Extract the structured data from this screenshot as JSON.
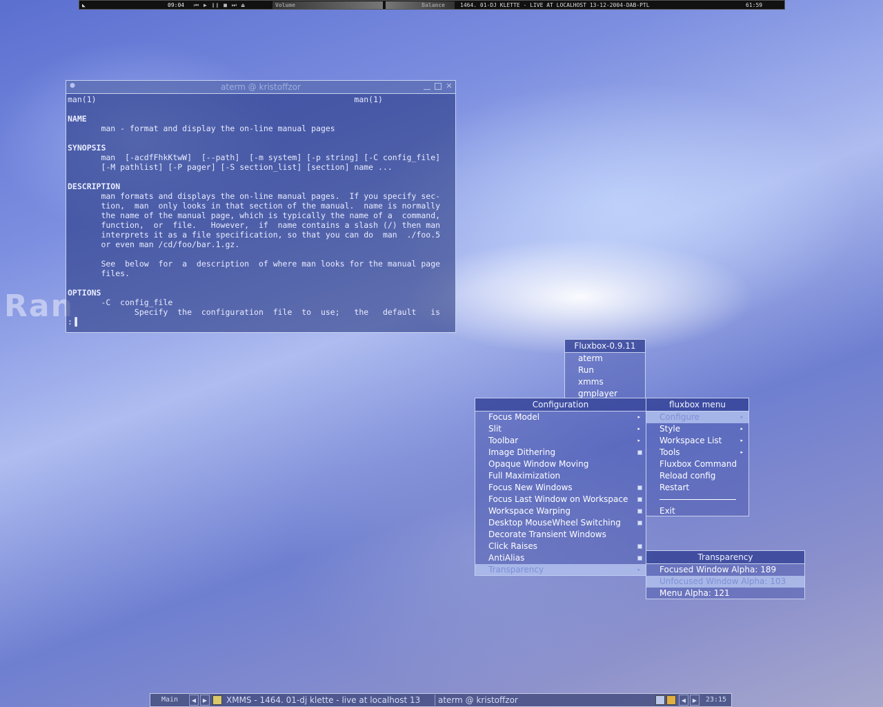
{
  "wallpaper": {
    "text": "Ran"
  },
  "xmms_bar": {
    "time": "09:04",
    "controls": "⏮ ▶ ❙❙ ■ ⏭ ⏏",
    "volume_label": "Volume",
    "balance_label": "Balance",
    "song_title": "1464. 01-DJ KLETTE - LIVE AT LOCALHOST 13-12-2004-DAB-PTL",
    "clock": "61:59"
  },
  "aterm": {
    "title": "aterm @ kristoffzor",
    "lines": [
      "man(1)                                                      man(1)",
      "",
      "NAME",
      "       man - format and display the on-line manual pages",
      "",
      "SYNOPSIS",
      "       man  [-acdfFhkKtwW]  [--path]  [-m system] [-p string] [-C config_file]",
      "       [-M pathlist] [-P pager] [-S section_list] [section] name ...",
      "",
      "DESCRIPTION",
      "       man formats and displays the on-line manual pages.  If you specify sec-",
      "       tion,  man  only looks in that section of the manual.  name is normally",
      "       the name of the manual page, which is typically the name of a  command,",
      "       function,  or  file.   However,  if  name contains a slash (/) then man",
      "       interprets it as a file specification, so that you can do  man  ./foo.5",
      "       or even man /cd/foo/bar.1.gz.",
      "",
      "       See  below  for  a  description  of where man looks for the manual page",
      "       files.",
      "",
      "OPTIONS",
      "       -C  config_file",
      "              Specify  the  configuration  file  to  use;   the   default   is",
      ":▐"
    ]
  },
  "root_menu": {
    "title": "Fluxbox-0.9.11",
    "items": [
      "aterm",
      "Run",
      "xmms",
      "gmplayer"
    ]
  },
  "fluxbox_menu": {
    "title": "fluxbox menu",
    "items": [
      {
        "label": "Configure",
        "submenu": true,
        "selected": true
      },
      {
        "label": "Style",
        "submenu": true
      },
      {
        "label": "Workspace List",
        "submenu": true
      },
      {
        "label": "Tools",
        "submenu": true
      },
      {
        "label": "Fluxbox Command"
      },
      {
        "label": "Reload config"
      },
      {
        "label": "Restart"
      },
      {
        "label": "Exit"
      }
    ]
  },
  "config_menu": {
    "title": "Configuration",
    "items": [
      {
        "label": "Focus Model",
        "submenu": true
      },
      {
        "label": "Slit",
        "submenu": true
      },
      {
        "label": "Toolbar",
        "submenu": true
      },
      {
        "label": "Image Dithering",
        "checked": true
      },
      {
        "label": "Opaque Window Moving"
      },
      {
        "label": "Full Maximization"
      },
      {
        "label": "Focus New Windows",
        "checked": true
      },
      {
        "label": "Focus Last Window on Workspace",
        "checked": true
      },
      {
        "label": "Workspace Warping",
        "checked": true
      },
      {
        "label": "Desktop MouseWheel Switching",
        "checked": true
      },
      {
        "label": "Decorate Transient Windows"
      },
      {
        "label": "Click Raises",
        "checked": true
      },
      {
        "label": "AntiAlias",
        "checked": true
      },
      {
        "label": "Transparency",
        "submenu": true,
        "selected": true
      }
    ]
  },
  "transparency_menu": {
    "title": "Transparency",
    "items": [
      {
        "label": "Focused Window Alpha:  189"
      },
      {
        "label": "Unfocused Window Alpha:  103",
        "selected": true
      },
      {
        "label": "Menu Alpha:  121"
      }
    ]
  },
  "toolbar": {
    "workspace": "Main",
    "tasks": [
      "XMMS - 1464. 01-dj klette - live at localhost 13",
      "aterm @ kristoffzor"
    ],
    "clock": "23:15",
    "prev_glyph": "◀",
    "next_glyph": "▶"
  }
}
